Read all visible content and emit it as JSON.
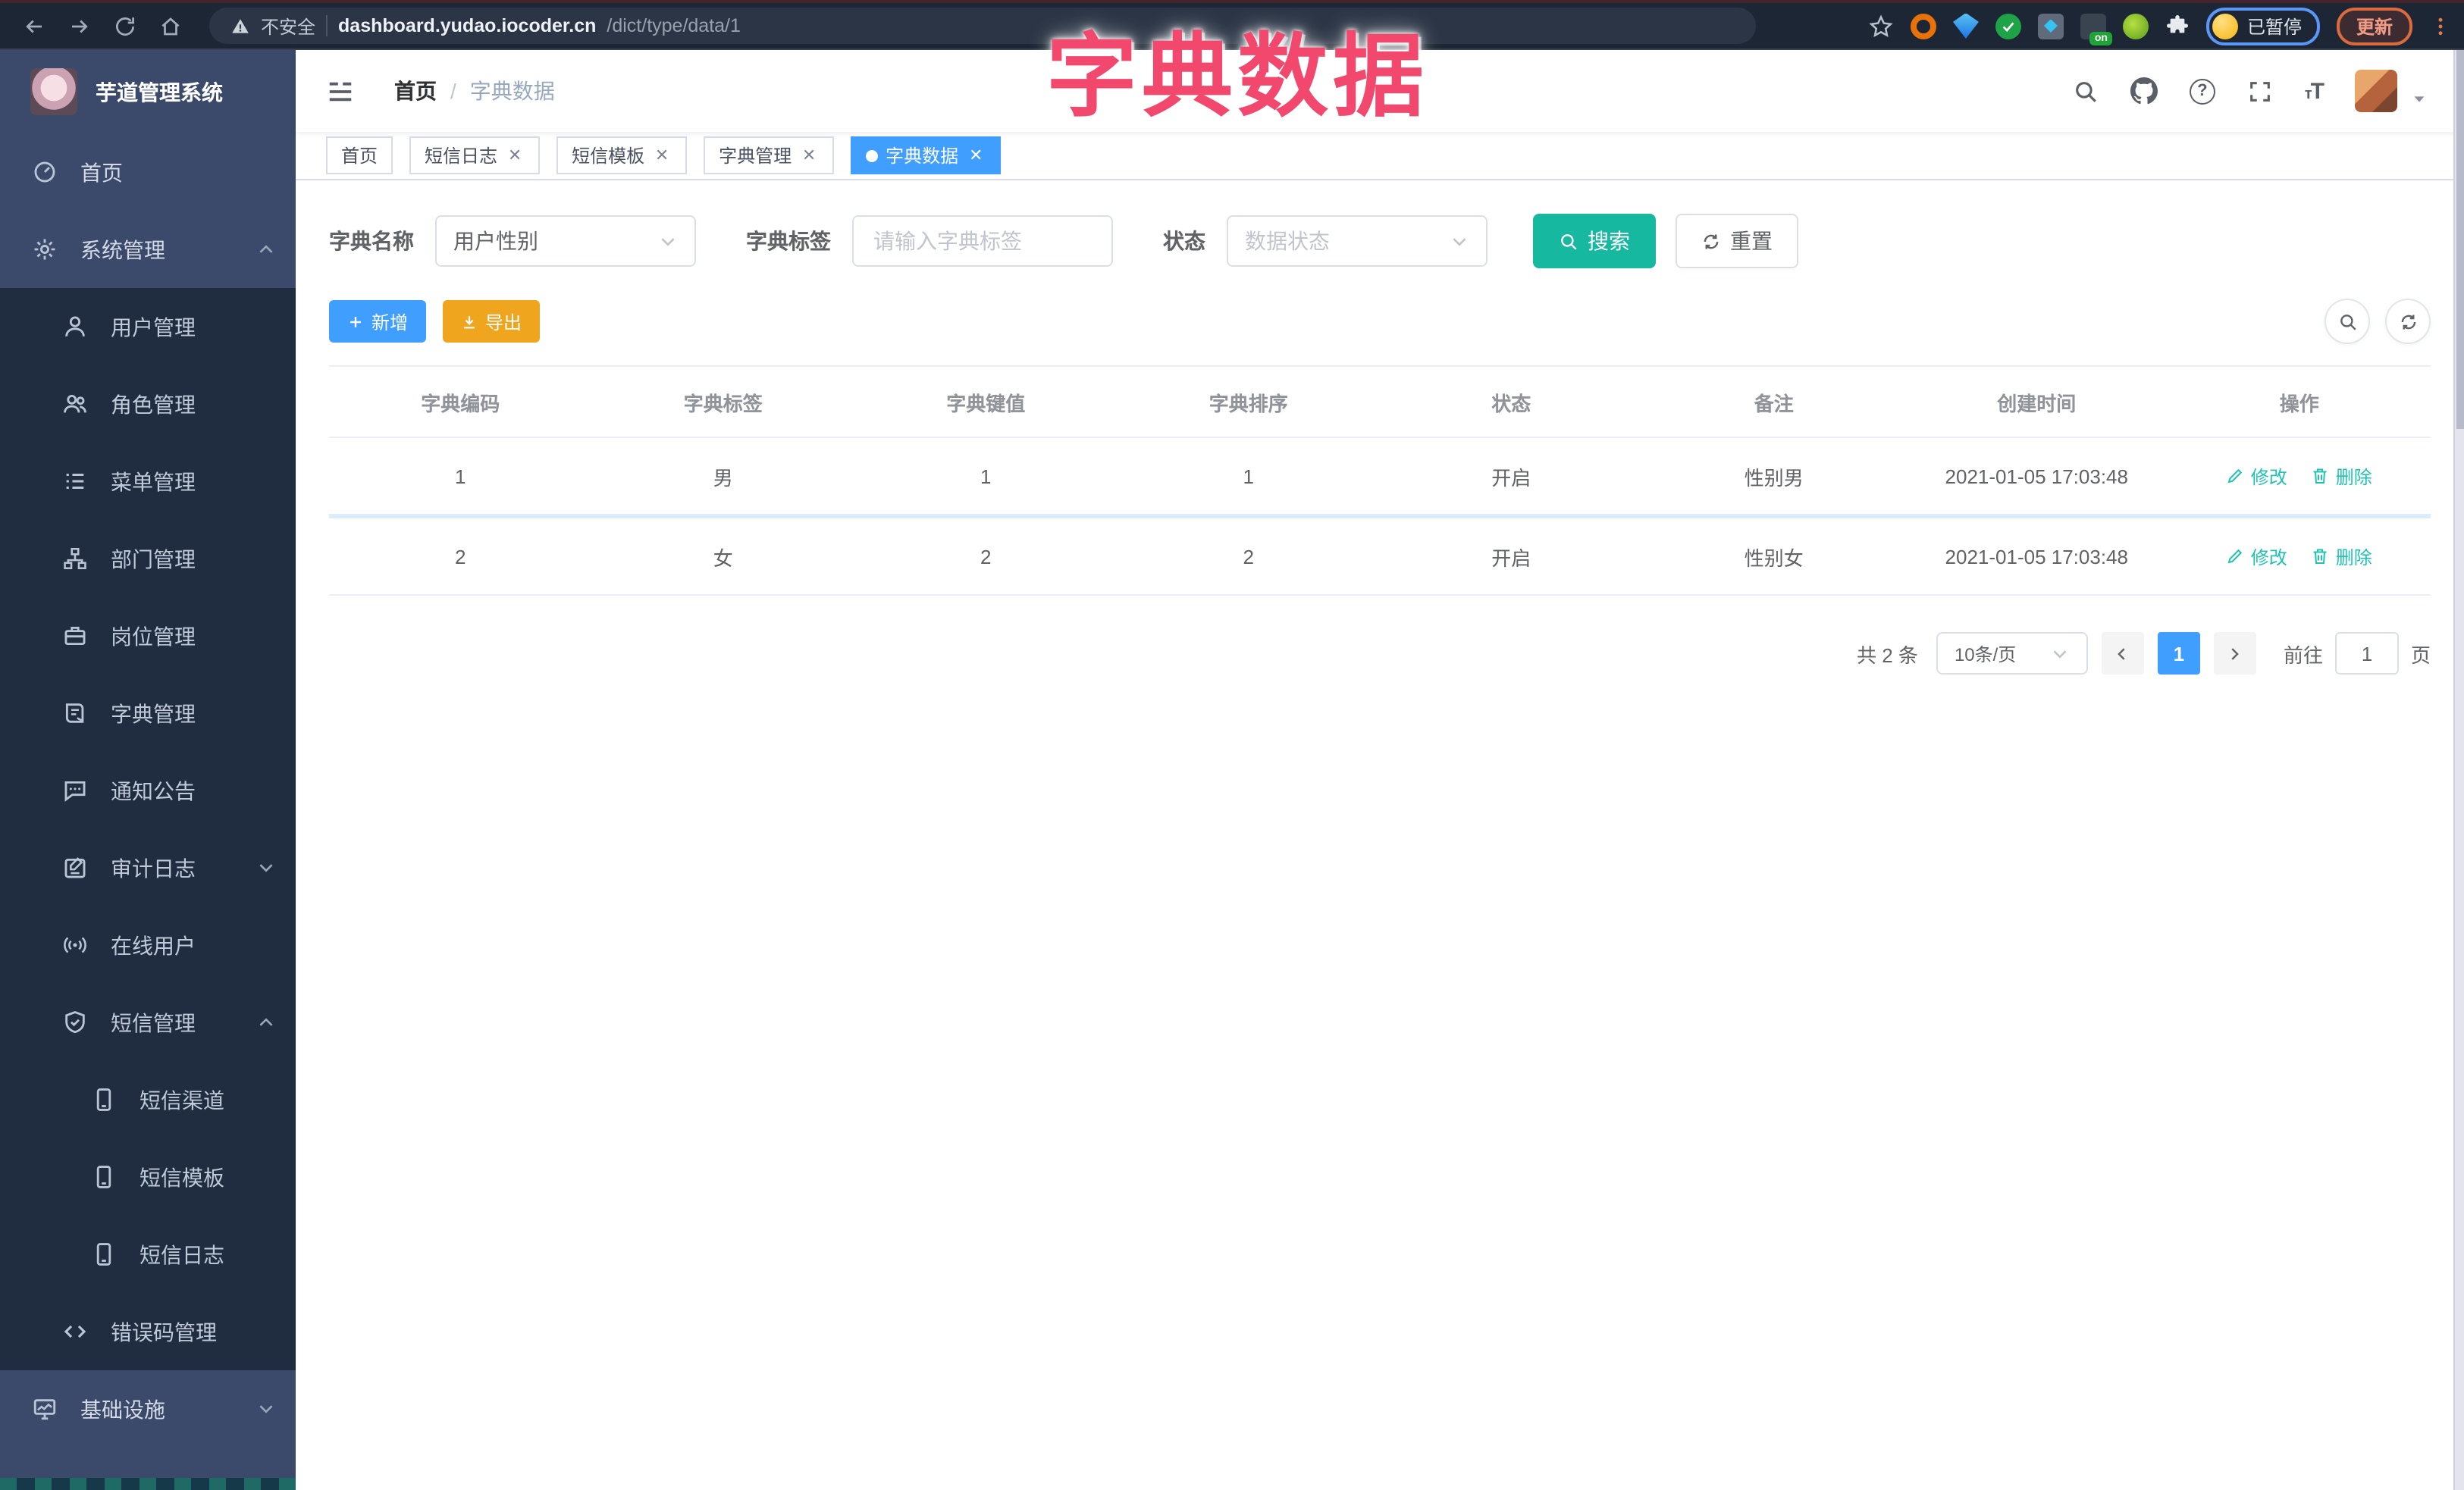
{
  "overlay": {
    "title": "字典数据"
  },
  "browser": {
    "security_label": "不安全",
    "url_host": "dashboard.yudao.iocoder.cn",
    "url_path": "/dict/type/data/1",
    "paused_badge": "已暂停",
    "update_button": "更新",
    "extension_on_badge": "on"
  },
  "sidebar": {
    "logo_title": "芋道管理系统",
    "items": [
      {
        "label": "首页"
      },
      {
        "label": "系统管理"
      },
      {
        "label": "用户管理"
      },
      {
        "label": "角色管理"
      },
      {
        "label": "菜单管理"
      },
      {
        "label": "部门管理"
      },
      {
        "label": "岗位管理"
      },
      {
        "label": "字典管理"
      },
      {
        "label": "通知公告"
      },
      {
        "label": "审计日志"
      },
      {
        "label": "在线用户"
      },
      {
        "label": "短信管理"
      },
      {
        "label": "短信渠道"
      },
      {
        "label": "短信模板"
      },
      {
        "label": "短信日志"
      },
      {
        "label": "错误码管理"
      },
      {
        "label": "基础设施"
      }
    ]
  },
  "header": {
    "breadcrumb": {
      "home": "首页",
      "separator": "/",
      "current": "字典数据"
    }
  },
  "tabs": [
    {
      "label": "首页"
    },
    {
      "label": "短信日志"
    },
    {
      "label": "短信模板"
    },
    {
      "label": "字典管理"
    },
    {
      "label": "字典数据"
    }
  ],
  "filters": {
    "dict_name_label": "字典名称",
    "dict_name_value": "用户性别",
    "dict_label_label": "字典标签",
    "dict_label_placeholder": "请输入字典标签",
    "status_label": "状态",
    "status_placeholder": "数据状态",
    "search_button": "搜索",
    "reset_button": "重置"
  },
  "toolbar": {
    "add_button": "新增",
    "export_button": "导出"
  },
  "table": {
    "headers": [
      "字典编码",
      "字典标签",
      "字典键值",
      "字典排序",
      "状态",
      "备注",
      "创建时间",
      "操作"
    ],
    "rows": [
      {
        "code": "1",
        "label": "男",
        "value": "1",
        "sort": "1",
        "status": "开启",
        "remark": "性别男",
        "created": "2021-01-05 17:03:48",
        "edit": "修改",
        "delete": "删除"
      },
      {
        "code": "2",
        "label": "女",
        "value": "2",
        "sort": "2",
        "status": "开启",
        "remark": "性别女",
        "created": "2021-01-05 17:03:48",
        "edit": "修改",
        "delete": "删除"
      }
    ]
  },
  "pagination": {
    "total": "共 2 条",
    "page_size": "10条/页",
    "current_page": "1",
    "goto_label": "前往",
    "goto_value": "1",
    "page_unit": "页"
  },
  "icons": {
    "search-icon": "magnifier",
    "github-icon": "octocat",
    "help-icon": "?",
    "fullscreen-icon": "expand",
    "font-size-icon": "tT",
    "hamburger-icon": "≡",
    "warning-icon": "⚠",
    "star-icon": "☆",
    "edit-icon": "pen",
    "delete-icon": "trash",
    "plus-icon": "+",
    "download-icon": "↓",
    "refresh-icon": "↻",
    "close-icon": "×",
    "chevron-up-icon": "︿",
    "chevron-down-icon": "﹀"
  }
}
